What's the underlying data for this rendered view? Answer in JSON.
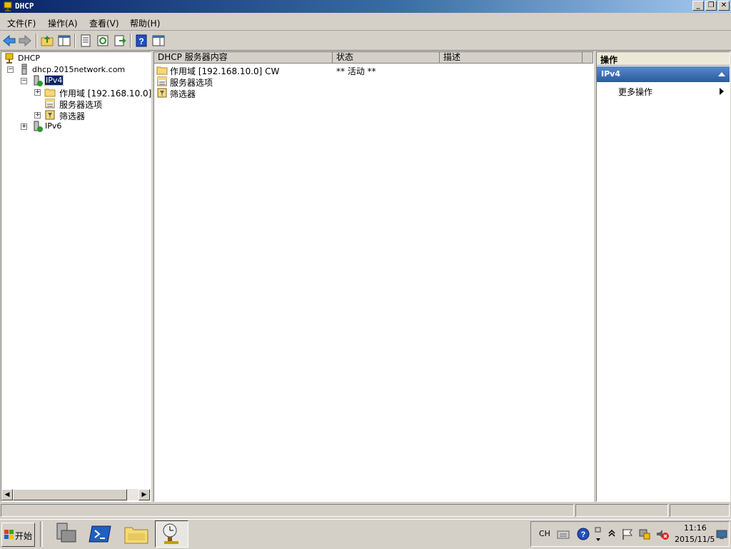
{
  "window": {
    "title": "DHCP"
  },
  "window_buttons": {
    "minimize": "_",
    "restore": "❐",
    "close": "✕"
  },
  "menu": [
    {
      "label": "文件(F)"
    },
    {
      "label": "操作(A)"
    },
    {
      "label": "查看(V)"
    },
    {
      "label": "帮助(H)"
    }
  ],
  "toolbar": {
    "icons": [
      "back-arrow-icon",
      "forward-arrow-icon",
      "up-folder-icon",
      "show-hide-tree-icon",
      "properties-icon",
      "refresh-icon",
      "export-icon",
      "help-icon",
      "show-action-pane-icon"
    ]
  },
  "tree": {
    "root": "DHCP",
    "server": "dhcp.2015network.com",
    "ipv4": "IPv4",
    "scope": "作用域 [192.168.10.0]",
    "server_options": "服务器选项",
    "filters": "筛选器",
    "ipv6": "IPv6",
    "expand_symbol": "+",
    "collapse_symbol": "−"
  },
  "list": {
    "columns": [
      "DHCP 服务器内容",
      "状态",
      "描述"
    ],
    "rows": [
      {
        "name": "作用域 [192.168.10.0] CW",
        "status": "** 活动 **",
        "desc": "",
        "icon": "folder-icon"
      },
      {
        "name": "服务器选项",
        "status": "",
        "desc": "",
        "icon": "server-options-icon"
      },
      {
        "name": "筛选器",
        "status": "",
        "desc": "",
        "icon": "filter-icon"
      }
    ]
  },
  "actions": {
    "header": "操作",
    "section": "IPv4",
    "more": "更多操作"
  },
  "taskbar": {
    "start_label": "开始",
    "lang": "CH",
    "time": "11:16",
    "date": "2015/11/5"
  },
  "colors": {
    "title_gradient_start": "#0a246a",
    "action_section": "#3a6ea5",
    "selection": "#0a246a"
  }
}
